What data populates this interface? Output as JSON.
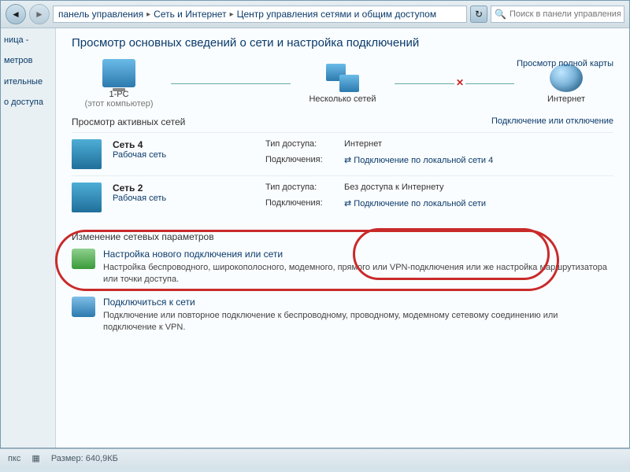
{
  "titlebar": {
    "minimize": "—",
    "maximize": "❐",
    "close": "✕"
  },
  "breadcrumb": {
    "level0": "панель управления",
    "level1": "Сеть и Интернет",
    "level2": "Центр управления сетями и общим доступом"
  },
  "search": {
    "placeholder": "Поиск в панели управления"
  },
  "sidebar": {
    "item0": "ница -",
    "item1": "метров",
    "item2": "ительные",
    "item3": "о доступа"
  },
  "page": {
    "title": "Просмотр основных сведений о сети и настройка подключений",
    "full_map_link": "Просмотр полной карты",
    "map_node_pc": "1-PC",
    "map_node_pc_sub": "(этот компьютер)",
    "map_node_multi": "Несколько сетей",
    "map_node_internet": "Интернет",
    "active_networks_label": "Просмотр активных сетей",
    "connect_disconnect": "Подключение или отключение",
    "change_params_title": "Изменение сетевых параметров"
  },
  "networks": [
    {
      "name": "Сеть 4",
      "type": "Рабочая сеть",
      "access_label": "Тип доступа:",
      "access_value": "Интернет",
      "conn_label": "Подключения:",
      "conn_link": "Подключение по локальной сети 4"
    },
    {
      "name": "Сеть 2",
      "type": "Рабочая сеть",
      "access_label": "Тип доступа:",
      "access_value": "Без доступа к Интернету",
      "conn_label": "Подключения:",
      "conn_link": "Подключение по локальной сети"
    }
  ],
  "options": [
    {
      "title": "Настройка нового подключения или сети",
      "desc": "Настройка беспроводного, широкополосного, модемного, прямого или VPN-подключения или же настройка маршрутизатора или точки доступа."
    },
    {
      "title": "Подключиться к сети",
      "desc": "Подключение или повторное подключение к беспроводному, проводному, модемному сетевому соединению или подключение к VPN."
    }
  ],
  "statusbar": {
    "left": "пкс",
    "size_label": "Размер:",
    "size_value": "640,9КБ"
  }
}
